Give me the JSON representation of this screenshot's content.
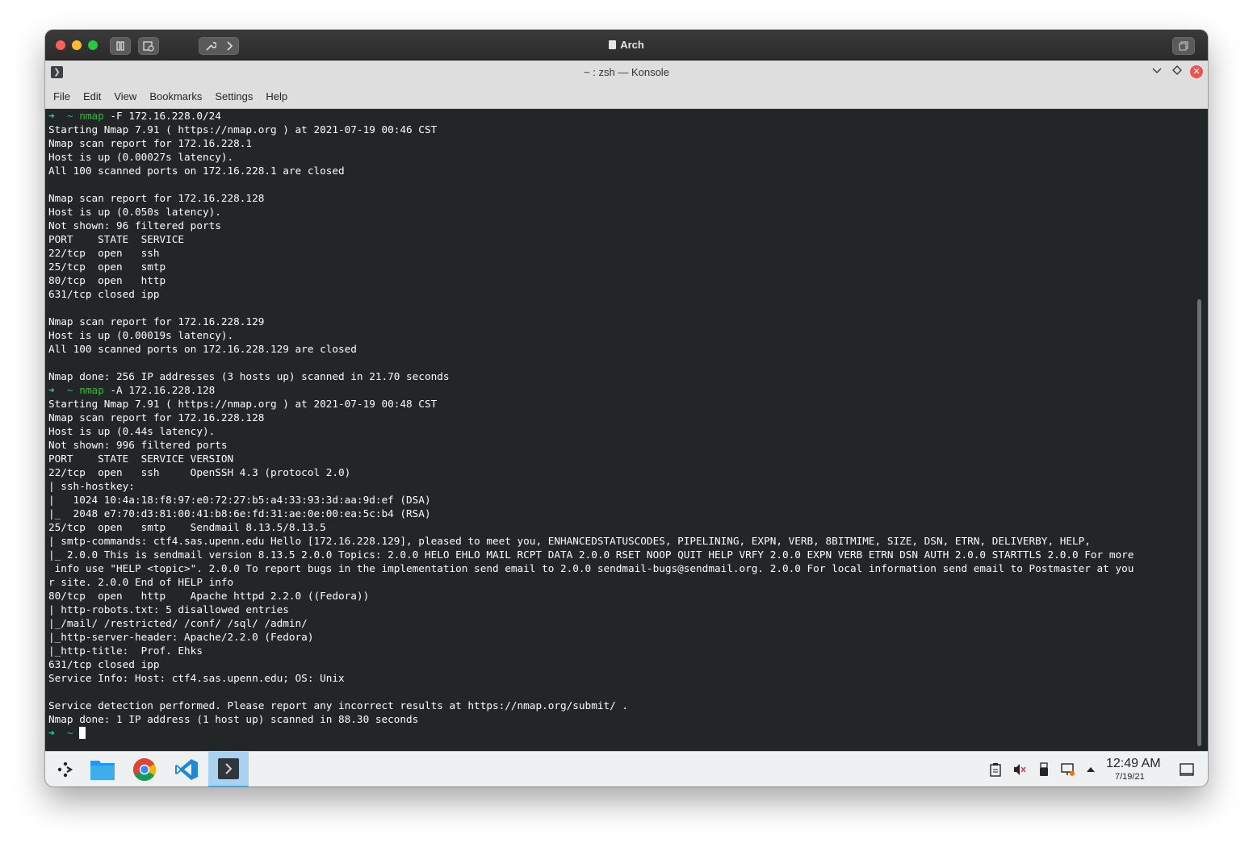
{
  "vm": {
    "title": "Arch"
  },
  "konsole": {
    "title": "~ : zsh — Konsole"
  },
  "menu": [
    "File",
    "Edit",
    "View",
    "Bookmarks",
    "Settings",
    "Help"
  ],
  "terminal": {
    "colors": {
      "background": "#232627",
      "foreground": "#fcfcfc",
      "prompt_arrow": "#1cdc9a",
      "command": "#11d116"
    },
    "prompt": {
      "arrow": "➜",
      "dir": "~"
    },
    "lines": [
      {
        "type": "cmd",
        "cmd": "nmap",
        "args": " -F 172.16.228.0/24"
      },
      {
        "type": "out",
        "text": "Starting Nmap 7.91 ( https://nmap.org ) at 2021-07-19 00:46 CST"
      },
      {
        "type": "out",
        "text": "Nmap scan report for 172.16.228.1"
      },
      {
        "type": "out",
        "text": "Host is up (0.00027s latency)."
      },
      {
        "type": "out",
        "text": "All 100 scanned ports on 172.16.228.1 are closed"
      },
      {
        "type": "out",
        "text": ""
      },
      {
        "type": "out",
        "text": "Nmap scan report for 172.16.228.128"
      },
      {
        "type": "out",
        "text": "Host is up (0.050s latency)."
      },
      {
        "type": "out",
        "text": "Not shown: 96 filtered ports"
      },
      {
        "type": "out",
        "text": "PORT    STATE  SERVICE"
      },
      {
        "type": "out",
        "text": "22/tcp  open   ssh"
      },
      {
        "type": "out",
        "text": "25/tcp  open   smtp"
      },
      {
        "type": "out",
        "text": "80/tcp  open   http"
      },
      {
        "type": "out",
        "text": "631/tcp closed ipp"
      },
      {
        "type": "out",
        "text": ""
      },
      {
        "type": "out",
        "text": "Nmap scan report for 172.16.228.129"
      },
      {
        "type": "out",
        "text": "Host is up (0.00019s latency)."
      },
      {
        "type": "out",
        "text": "All 100 scanned ports on 172.16.228.129 are closed"
      },
      {
        "type": "out",
        "text": ""
      },
      {
        "type": "out",
        "text": "Nmap done: 256 IP addresses (3 hosts up) scanned in 21.70 seconds"
      },
      {
        "type": "cmd",
        "cmd": "nmap",
        "args": " -A 172.16.228.128"
      },
      {
        "type": "out",
        "text": "Starting Nmap 7.91 ( https://nmap.org ) at 2021-07-19 00:48 CST"
      },
      {
        "type": "out",
        "text": "Nmap scan report for 172.16.228.128"
      },
      {
        "type": "out",
        "text": "Host is up (0.44s latency)."
      },
      {
        "type": "out",
        "text": "Not shown: 996 filtered ports"
      },
      {
        "type": "out",
        "text": "PORT    STATE  SERVICE VERSION"
      },
      {
        "type": "out",
        "text": "22/tcp  open   ssh     OpenSSH 4.3 (protocol 2.0)"
      },
      {
        "type": "out",
        "text": "| ssh-hostkey:"
      },
      {
        "type": "out",
        "text": "|   1024 10:4a:18:f8:97:e0:72:27:b5:a4:33:93:3d:aa:9d:ef (DSA)"
      },
      {
        "type": "out",
        "text": "|_  2048 e7:70:d3:81:00:41:b8:6e:fd:31:ae:0e:00:ea:5c:b4 (RSA)"
      },
      {
        "type": "out",
        "text": "25/tcp  open   smtp    Sendmail 8.13.5/8.13.5"
      },
      {
        "type": "out",
        "text": "| smtp-commands: ctf4.sas.upenn.edu Hello [172.16.228.129], pleased to meet you, ENHANCEDSTATUSCODES, PIPELINING, EXPN, VERB, 8BITMIME, SIZE, DSN, ETRN, DELIVERBY, HELP,"
      },
      {
        "type": "out",
        "text": "|_ 2.0.0 This is sendmail version 8.13.5 2.0.0 Topics: 2.0.0 HELO EHLO MAIL RCPT DATA 2.0.0 RSET NOOP QUIT HELP VRFY 2.0.0 EXPN VERB ETRN DSN AUTH 2.0.0 STARTTLS 2.0.0 For more"
      },
      {
        "type": "out",
        "text": " info use \"HELP <topic>\". 2.0.0 To report bugs in the implementation send email to 2.0.0 sendmail-bugs@sendmail.org. 2.0.0 For local information send email to Postmaster at you"
      },
      {
        "type": "out",
        "text": "r site. 2.0.0 End of HELP info"
      },
      {
        "type": "out",
        "text": "80/tcp  open   http    Apache httpd 2.2.0 ((Fedora))"
      },
      {
        "type": "out",
        "text": "| http-robots.txt: 5 disallowed entries"
      },
      {
        "type": "out",
        "text": "|_/mail/ /restricted/ /conf/ /sql/ /admin/"
      },
      {
        "type": "out",
        "text": "|_http-server-header: Apache/2.2.0 (Fedora)"
      },
      {
        "type": "out",
        "text": "|_http-title:  Prof. Ehks"
      },
      {
        "type": "out",
        "text": "631/tcp closed ipp"
      },
      {
        "type": "out",
        "text": "Service Info: Host: ctf4.sas.upenn.edu; OS: Unix"
      },
      {
        "type": "out",
        "text": ""
      },
      {
        "type": "out",
        "text": "Service detection performed. Please report any incorrect results at https://nmap.org/submit/ ."
      },
      {
        "type": "out",
        "text": "Nmap done: 1 IP address (1 host up) scanned in 88.30 seconds"
      },
      {
        "type": "prompt"
      }
    ]
  },
  "taskbar": {
    "apps": [
      {
        "name": "application-launcher-icon"
      },
      {
        "name": "dolphin-file-manager-icon"
      },
      {
        "name": "google-chrome-icon"
      },
      {
        "name": "vscode-icon"
      },
      {
        "name": "konsole-icon",
        "active": true
      }
    ],
    "tray": [
      "clipboard-icon",
      "volume-muted-icon",
      "usb-device-icon",
      "network-icon",
      "expand-tray-icon"
    ],
    "clock": {
      "time": "12:49 AM",
      "date": "7/19/21"
    }
  }
}
